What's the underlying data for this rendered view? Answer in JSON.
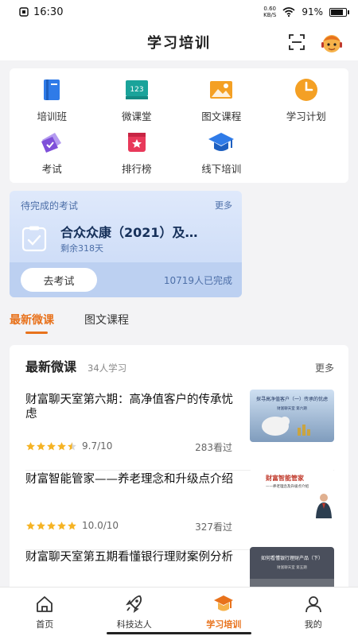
{
  "status_bar": {
    "time": "16:30",
    "net_speed_value": "0.60",
    "net_speed_unit": "KB/S",
    "battery_percent": "91%",
    "battery_level": 0.91
  },
  "header": {
    "title": "学习培训",
    "scan_icon": "scan-icon",
    "avatar_icon": "mascot-icon"
  },
  "features": [
    {
      "label": "培训班",
      "icon": "book-icon",
      "color": "#2f7be8"
    },
    {
      "label": "微课堂",
      "icon": "board-icon",
      "color": "#1aa39a",
      "badge": "123"
    },
    {
      "label": "图文课程",
      "icon": "picture-icon",
      "color": "#f4a024"
    },
    {
      "label": "学习计划",
      "icon": "clock-icon",
      "color": "#f4a024"
    },
    {
      "label": "考试",
      "icon": "exam-icon",
      "color": "#7e4fd9"
    },
    {
      "label": "排行榜",
      "icon": "ranking-icon",
      "color": "#e8395a"
    },
    {
      "label": "线下培训",
      "icon": "graduation-cap-icon",
      "color": "#2f7be8"
    }
  ],
  "exam": {
    "header": "待完成的考试",
    "more": "更多",
    "name": "合众众康（2021）及…",
    "remaining": "剩余318天",
    "button": "去考试",
    "completed": "10719人已完成"
  },
  "tabs": [
    {
      "label": "最新微课",
      "active": true
    },
    {
      "label": "图文课程",
      "active": false
    }
  ],
  "panel": {
    "title": "最新微课",
    "learners": "34人学习",
    "more": "更多",
    "courses": [
      {
        "title": "财富聊天室第六期：高净值客户的传承忧虑",
        "rating": "9.7/10",
        "stars": 4.5,
        "views": "283看过",
        "thumb_text": "探寻高净值客户（一）传承的忧虑",
        "thumb_sub": "财富聊天室 第六期"
      },
      {
        "title": "财富智能管家——养老理念和升级点介绍",
        "rating": "10.0/10",
        "stars": 5,
        "views": "327看过",
        "thumb_text": "财富智能管家",
        "thumb_sub": "——养老理念及升级点介绍"
      },
      {
        "title": "财富聊天室第五期看懂银行理财案例分析",
        "rating": "",
        "stars": 0,
        "views": "",
        "thumb_text": "如何看懂银行理财产品（下）",
        "thumb_sub": "财富聊天室 第五期"
      }
    ]
  },
  "bottom_nav": [
    {
      "label": "首页",
      "icon": "home-icon",
      "active": false
    },
    {
      "label": "科技达人",
      "icon": "rocket-icon",
      "active": false
    },
    {
      "label": "学习培训",
      "icon": "study-icon",
      "active": true
    },
    {
      "label": "我的",
      "icon": "user-icon",
      "active": false
    }
  ],
  "colors": {
    "accent": "#e8721c",
    "exam_blue": "#4d6fa8",
    "star": "#f5b324"
  }
}
